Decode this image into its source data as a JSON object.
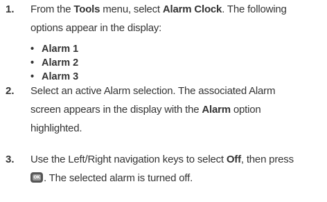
{
  "steps": [
    {
      "number": "1.",
      "line1_pre": "From the ",
      "line1_bold1": "Tools",
      "line1_mid": " menu, select ",
      "line1_bold2": "Alarm Clock",
      "line1_post": ". The following",
      "line2": "options appear in the display:",
      "bullets": [
        "Alarm 1",
        "Alarm 2",
        "Alarm 3"
      ]
    },
    {
      "number": "2.",
      "line1": "Select an active Alarm selection. The associated Alarm",
      "line2_pre": "screen appears in the display with the ",
      "line2_bold": "Alarm",
      "line2_post": " option",
      "line3": "highlighted."
    },
    {
      "number": "3.",
      "line1_pre": "Use the Left/Right navigation keys to select ",
      "line1_bold": "Off",
      "line1_post": ", then press",
      "line2_post": ". The selected alarm is turned off.",
      "key_label": "OK",
      "key_icon": "ok-key-icon"
    }
  ],
  "bullet_glyph": "•"
}
